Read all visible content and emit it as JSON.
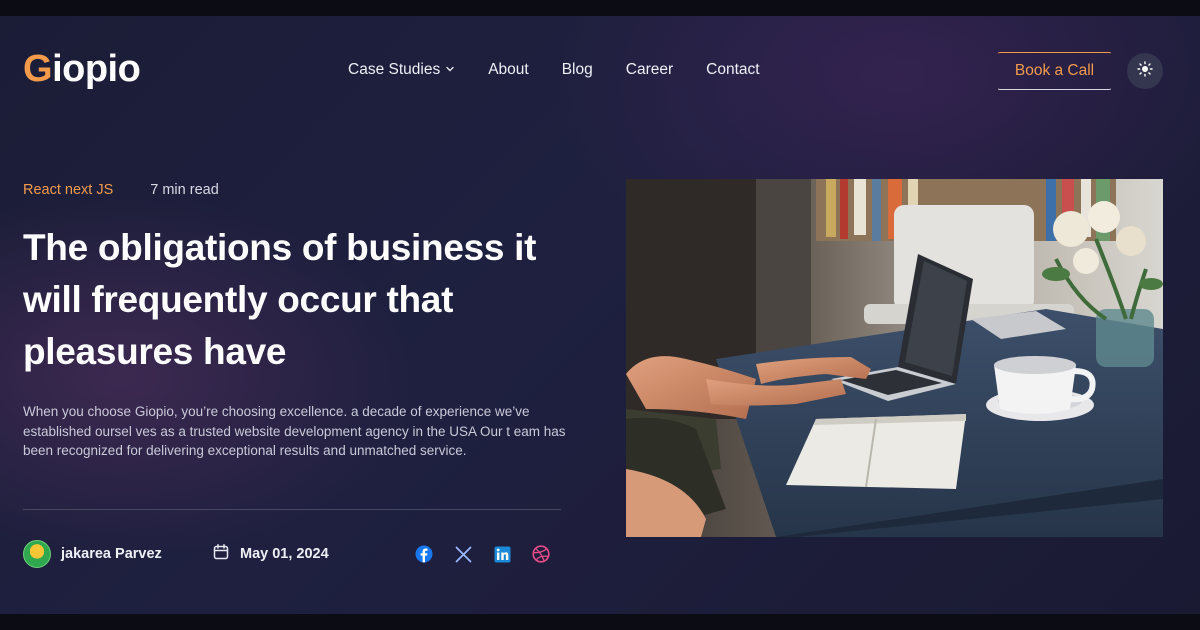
{
  "brand": {
    "logo_initial": "G",
    "logo_rest": "iopio",
    "accent": "#f39a4b"
  },
  "nav": {
    "items": [
      {
        "label": "Case Studies",
        "has_dropdown": true
      },
      {
        "label": "About"
      },
      {
        "label": "Blog"
      },
      {
        "label": "Career"
      },
      {
        "label": "Contact"
      }
    ],
    "cta_label": "Book a Call",
    "theme_icon": "sun-icon"
  },
  "post": {
    "category": "React next JS",
    "read_time": "7 min read",
    "title": "The obligations of business it will frequently occur that pleasures have",
    "description": "When you choose Giopio, you’re choosing excellence. a decade of experience we’ve established oursel ves as a trusted website development agency in the USA Our t eam has been recognized for delivering exceptional results and unmatched service.",
    "author": "jakarea Parvez",
    "date": "May 01, 2024",
    "socials": [
      {
        "icon": "facebook-icon",
        "color": "#1877f2"
      },
      {
        "icon": "x-twitter-icon",
        "color": "#9ab8ff"
      },
      {
        "icon": "linkedin-icon",
        "color": "#1a8ad8"
      },
      {
        "icon": "dribbble-icon",
        "color": "#ea4c89"
      }
    ],
    "image_icon": "laptop-desk-photo"
  }
}
